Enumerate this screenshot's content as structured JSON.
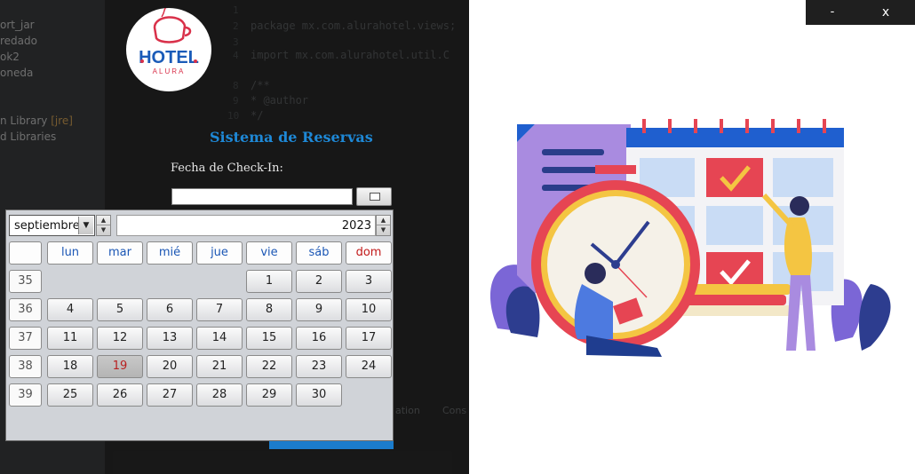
{
  "ide": {
    "tree_items": [
      "ort_jar",
      "redado",
      "ok2",
      "oneda",
      "n Library",
      "d Libraries"
    ],
    "jre_tag": "[jre]",
    "code_lines": [
      {
        "num": "1",
        "text": ""
      },
      {
        "num": "2",
        "text": "package mx.com.alurahotel.views;"
      },
      {
        "num": "3",
        "text": ""
      },
      {
        "num": "4",
        "text": "import mx.com.alurahotel.util.C"
      },
      {
        "num": "8",
        "text": "/**"
      },
      {
        "num": "9",
        "text": " * @author"
      },
      {
        "num": "10",
        "text": " */"
      }
    ],
    "bottom_tabs": [
      "ation",
      "Cons"
    ]
  },
  "app": {
    "logo_text_main": "HOTEL",
    "logo_text_sub": "ALURA",
    "title": "Sistema de Reservas",
    "checkin_label": "Fecha de Check-In:",
    "checkin_value": ""
  },
  "calendar": {
    "month": "septiembre",
    "year": "2023",
    "weekday_headers": [
      "lun",
      "mar",
      "mié",
      "jue",
      "vie",
      "sáb",
      "dom"
    ],
    "weeks": [
      {
        "week": "35",
        "days": [
          "",
          "",
          "",
          "",
          "1",
          "2",
          "3"
        ]
      },
      {
        "week": "36",
        "days": [
          "4",
          "5",
          "6",
          "7",
          "8",
          "9",
          "10"
        ]
      },
      {
        "week": "37",
        "days": [
          "11",
          "12",
          "13",
          "14",
          "15",
          "16",
          "17"
        ]
      },
      {
        "week": "38",
        "days": [
          "18",
          "19",
          "20",
          "21",
          "22",
          "23",
          "24"
        ]
      },
      {
        "week": "39",
        "days": [
          "25",
          "26",
          "27",
          "28",
          "29",
          "30",
          ""
        ]
      }
    ],
    "today": "19",
    "today_color": "#b82020",
    "sunday_color": "#c21a1a",
    "weekday_color": "#1a56b5"
  },
  "window": {
    "minimize_label": "-",
    "close_label": "x"
  },
  "colors": {
    "title_blue": "#1e88d6",
    "accent_red": "#e64553",
    "illustration_blue": "#1f5fcf"
  }
}
